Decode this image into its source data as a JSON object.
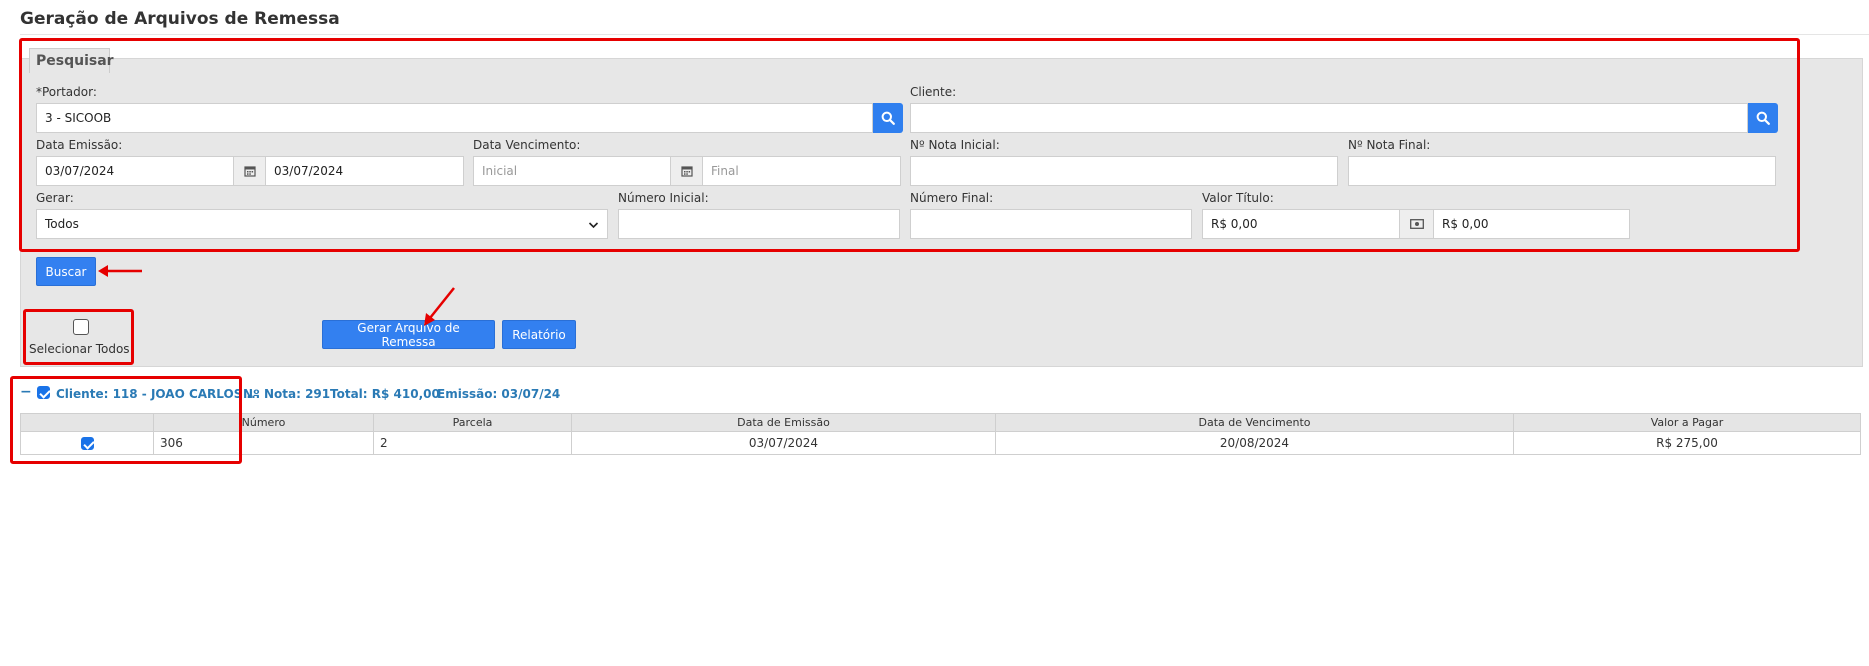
{
  "page": {
    "title": "Geração de Arquivos de Remessa"
  },
  "search": {
    "tab_label": "Pesquisar",
    "portador": {
      "label": "*Portador:",
      "value": "3 - SICOOB"
    },
    "cliente": {
      "label": "Cliente:",
      "value": ""
    },
    "data_emissao": {
      "label": "Data Emissão:",
      "start": "03/07/2024",
      "end": "03/07/2024"
    },
    "data_vencimento": {
      "label": "Data Vencimento:",
      "start_placeholder": "Inicial",
      "end_placeholder": "Final"
    },
    "nota_inicial": {
      "label": "Nº Nota Inicial:",
      "value": ""
    },
    "nota_final": {
      "label": "Nº Nota Final:",
      "value": ""
    },
    "gerar": {
      "label": "Gerar:",
      "selected": "Todos"
    },
    "numero_inicial": {
      "label": "Número Inicial:",
      "value": ""
    },
    "numero_final": {
      "label": "Número Final:",
      "value": ""
    },
    "valor_titulo": {
      "label": "Valor Título:",
      "start": "R$ 0,00",
      "end": "R$ 0,00"
    },
    "buscar_label": "Buscar"
  },
  "actions": {
    "select_all_label": "Selecionar Todos",
    "gerar_remessa_label": "Gerar Arquivo de Remessa",
    "relatorio_label": "Relatório"
  },
  "group": {
    "collapse_symbol": "−",
    "cliente": "Cliente: 118 - JOAO CARLOS ...",
    "nota": "Nº Nota: 291",
    "total": "Total: R$ 410,00",
    "emissao": "Emissão: 03/07/24"
  },
  "table": {
    "headers": [
      "",
      "Número",
      "Parcela",
      "Data de Emissão",
      "Data de Vencimento",
      "Valor a Pagar"
    ],
    "rows": [
      {
        "checked": true,
        "numero": "306",
        "parcela": "2",
        "data_emissao": "03/07/2024",
        "data_vencimento": "20/08/2024",
        "valor": "R$ 275,00"
      }
    ]
  },
  "colors": {
    "primary": "#3380f0",
    "highlight": "#e60000",
    "link": "#2a7ab5",
    "panel": "#e7e7e7"
  }
}
